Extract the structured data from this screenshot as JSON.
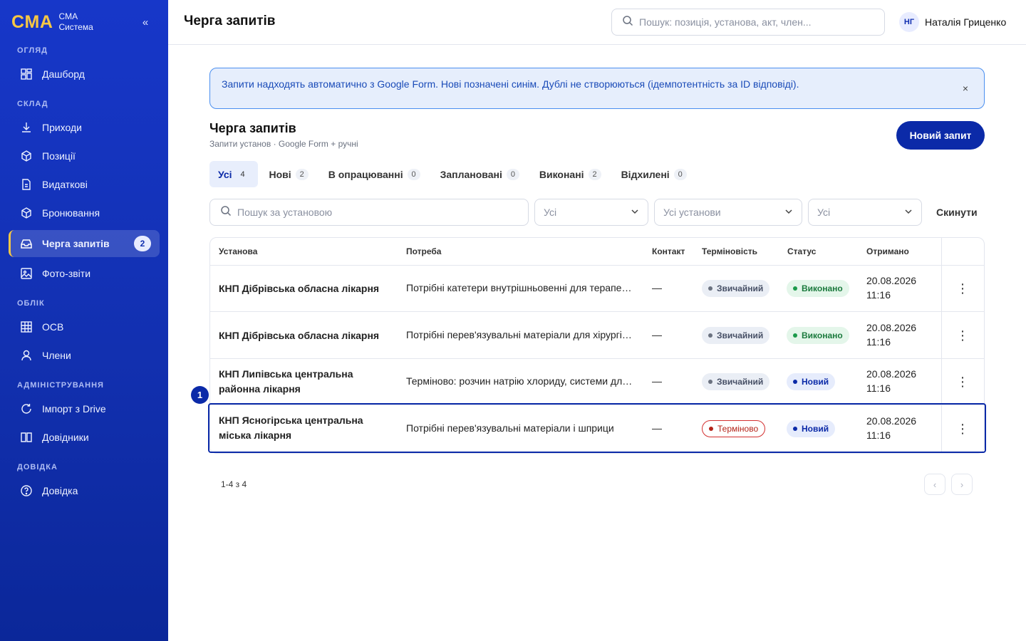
{
  "sidebar": {
    "logo": "CMA",
    "brand_line1": "CMA",
    "brand_line2": "Система",
    "collapse_icon": "«",
    "sections": {
      "overview": "ОГЛЯД",
      "warehouse": "СКЛАД",
      "accounting": "ОБЛІК",
      "admin": "АДМІНІСТРУВАННЯ",
      "help": "ДОВІДКА"
    },
    "items": [
      {
        "label": "Дашборд",
        "icon": "dashboard-icon"
      },
      {
        "label": "Приходи",
        "icon": "download-icon"
      },
      {
        "label": "Позиції",
        "icon": "box-icon"
      },
      {
        "label": "Видаткові",
        "icon": "document-icon"
      },
      {
        "label": "Бронювання",
        "icon": "box-icon"
      },
      {
        "label": "Черга запитів",
        "icon": "inbox-icon",
        "badge": "2",
        "active": true
      },
      {
        "label": "Фото-звіти",
        "icon": "image-icon"
      },
      {
        "label": "ОСВ",
        "icon": "grid-icon"
      },
      {
        "label": "Члени",
        "icon": "user-icon"
      },
      {
        "label": "Імпорт з Drive",
        "icon": "refresh-icon"
      },
      {
        "label": "Довідники",
        "icon": "book-icon"
      },
      {
        "label": "Довідка",
        "icon": "help-icon"
      }
    ]
  },
  "header": {
    "title": "Черга запитів",
    "search_placeholder": "Пошук: позиція, установа, акт, член...",
    "user_initials": "НГ",
    "user_name": "Наталія Гриценко"
  },
  "banner": {
    "text": "Запити надходять автоматично з Google Form. Нові позначені синім. Дублі не створюються (ідемпотентність за ID відповіді).",
    "close": "×"
  },
  "page": {
    "title": "Черга запитів",
    "subtitle": "Запити установ · Google Form + ручні",
    "new_button": "Новий запит"
  },
  "tabs": [
    {
      "label": "Усі",
      "count": "4",
      "active": true
    },
    {
      "label": "Нові",
      "count": "2"
    },
    {
      "label": "В опрацюванні",
      "count": "0"
    },
    {
      "label": "Заплановані",
      "count": "0"
    },
    {
      "label": "Виконані",
      "count": "2"
    },
    {
      "label": "Відхилені",
      "count": "0"
    }
  ],
  "filters": {
    "search_placeholder": "Пошук за установою",
    "select1": "Усі",
    "select2": "Усі установи",
    "select3": "Усі",
    "reset": "Скинути"
  },
  "table": {
    "headers": [
      "Установа",
      "Потреба",
      "Контакт",
      "Терміновість",
      "Статус",
      "Отримано"
    ],
    "rows": [
      {
        "institution": "КНП Дібрівська обласна лікарня",
        "need": "Потрібні катетери внутрішньовенні для терапевтичного відділення",
        "contact": "—",
        "urgency": "Звичайний",
        "status": "Виконано",
        "date": "20.08.2026",
        "time": "11:16"
      },
      {
        "institution": "КНП Дібрівська обласна лікарня",
        "need": "Потрібні перев'язувальні матеріали для хірургічного відділення",
        "contact": "—",
        "urgency": "Звичайний",
        "status": "Виконано",
        "date": "20.08.2026",
        "time": "11:16"
      },
      {
        "institution": "КНП Липівська центральна районна лікарня",
        "need": "Терміново: розчин натрію хлориду, системи для інфузій",
        "contact": "—",
        "urgency": "Звичайний",
        "status": "Новий",
        "date": "20.08.2026",
        "time": "11:16"
      },
      {
        "institution": "КНП Ясногірська центральна міська лікарня",
        "need": "Потрібні перев'язувальні матеріали і шприци",
        "contact": "—",
        "urgency": "Терміново",
        "status": "Новий",
        "date": "20.08.2026",
        "time": "11:16"
      }
    ],
    "kebab": "⋮"
  },
  "step_marker": "1",
  "pagination": {
    "text": "1-4 з 4",
    "prev": "‹",
    "next": "›"
  }
}
